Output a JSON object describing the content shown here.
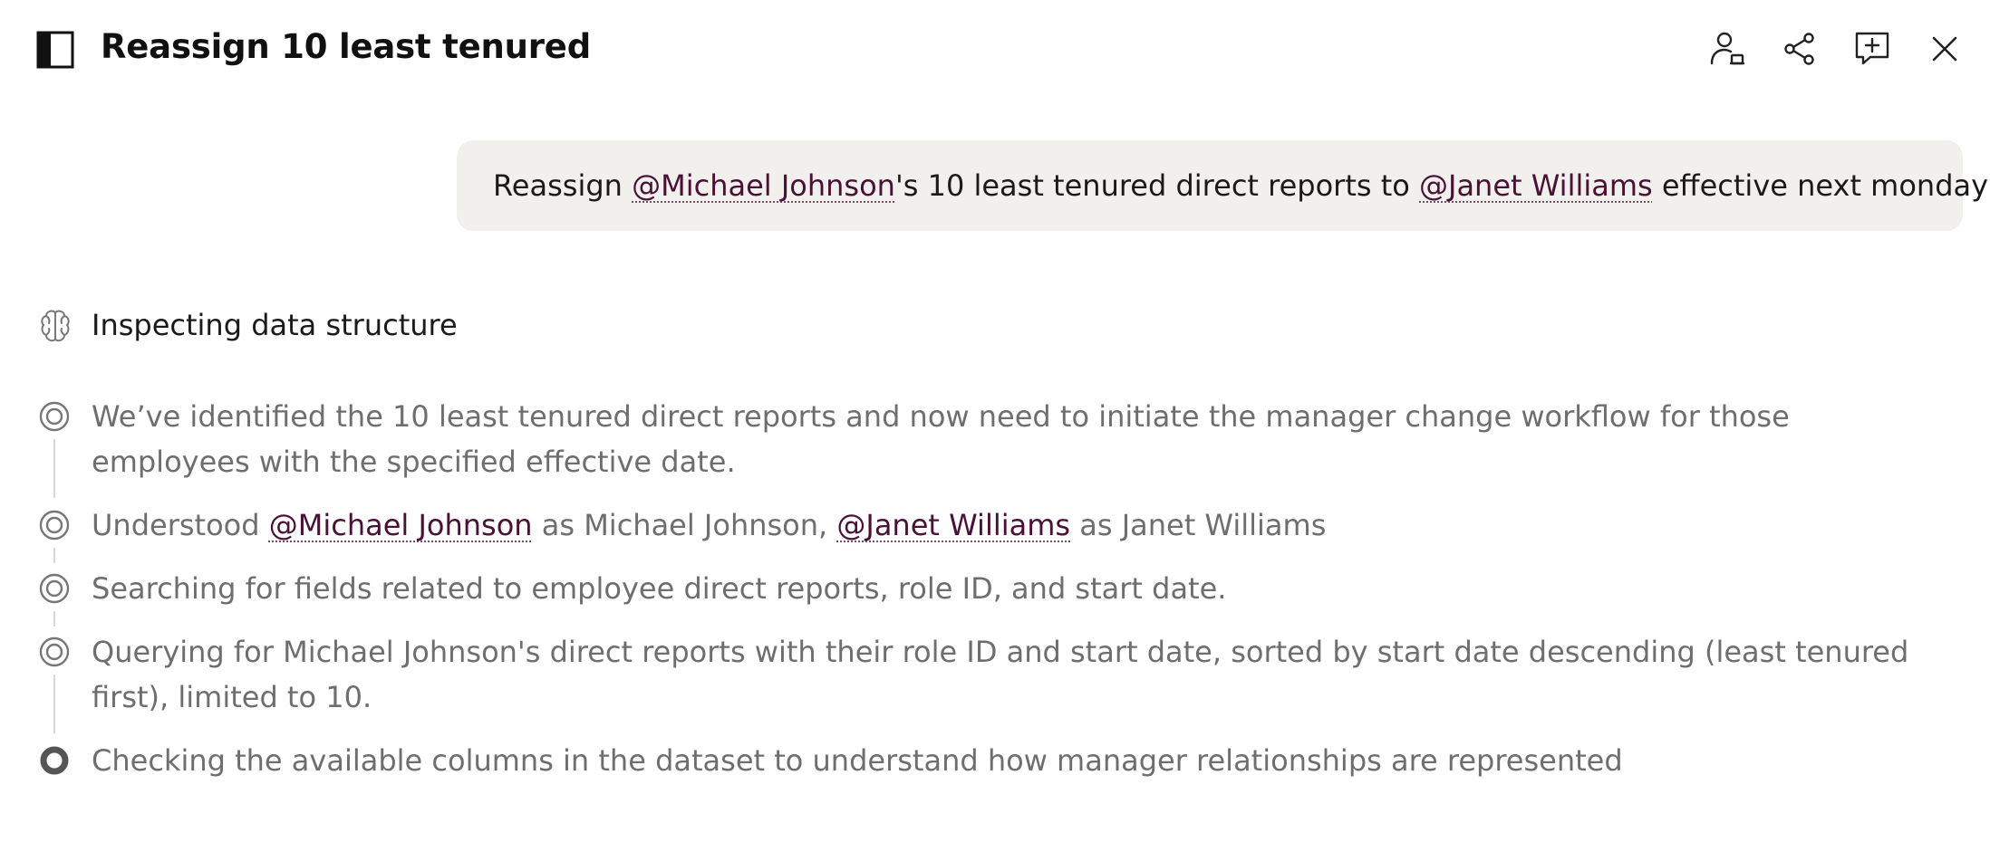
{
  "header": {
    "title": "Reassign 10 least tenured",
    "icons": [
      "sidebar-toggle-icon",
      "user-settings-icon",
      "share-icon",
      "add-comment-icon",
      "close-icon"
    ]
  },
  "prompt": {
    "part1": "Reassign ",
    "mention1": "@Michael Johnson",
    "part2": "'s 10 least tenured direct reports to ",
    "mention2": "@Janet Williams",
    "part3": " effective next monday"
  },
  "thinking": {
    "label": "Inspecting data structure"
  },
  "steps": {
    "s1": "We’ve identified the 10 least tenured direct reports and now need to initiate the manager change workflow for those employees with the specified effective date.",
    "s2_prefix": "Understood ",
    "s2_mention1": "@Michael Johnson",
    "s2_mid": " as Michael Johnson, ",
    "s2_mention2": "@Janet Williams",
    "s2_suffix": " as Janet Williams",
    "s3": "Searching for fields related to employee direct reports, role ID, and start date.",
    "s4": "Querying for Michael Johnson's direct reports with their role ID and start date, sorted by start date descending (least tenured first), limited to 10.",
    "s5": "Checking the available columns in the dataset to understand how manager relationships are represented"
  },
  "colors": {
    "bubble_bg": "#f1f0ed",
    "mention": "#4a1036",
    "step_text": "#6e6e6e",
    "timeline": "#d8d8d8"
  }
}
